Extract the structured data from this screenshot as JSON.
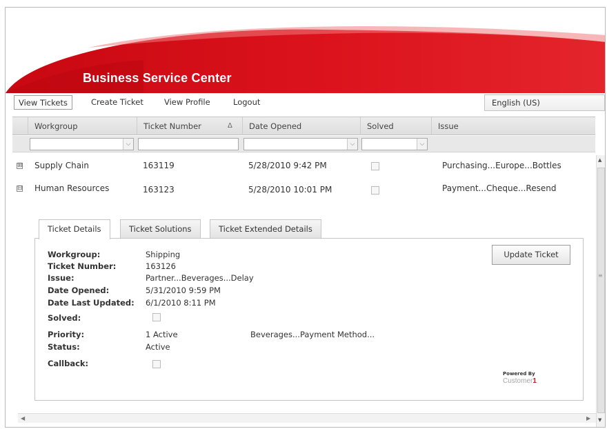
{
  "header": {
    "title": "Business Service Center"
  },
  "menu": {
    "items": [
      "View Tickets",
      "Create Ticket",
      "View Profile",
      "Logout"
    ],
    "language": "English (US)"
  },
  "grid": {
    "columns": [
      "Workgroup",
      "Ticket Number",
      "Date Opened",
      "Solved",
      "Issue"
    ],
    "sort_indicator": "Δ",
    "rows": [
      {
        "expander": "⊞",
        "workgroup": "Supply Chain",
        "ticket_number": "163119",
        "date_opened": "5/28/2010 9:42 PM",
        "issue": "Purchasing...Europe...Bottles"
      },
      {
        "expander": "⊟",
        "workgroup": "Human Resources",
        "ticket_number": "163123",
        "date_opened": "5/28/2010 10:01 PM",
        "issue": "Payment...Cheque...Resend"
      }
    ]
  },
  "detail": {
    "tabs": [
      "Ticket Details",
      "Ticket Solutions",
      "Ticket Extended Details"
    ],
    "labels": {
      "workgroup": "Workgroup:",
      "ticket_number": "Ticket Number:",
      "issue": "Issue:",
      "date_opened": "Date Opened:",
      "date_last_updated": "Date Last Updated:",
      "solved": "Solved:",
      "priority": "Priority:",
      "status": "Status:",
      "callback": "Callback:"
    },
    "values": {
      "workgroup": "Shipping",
      "ticket_number": "163126",
      "issue": "Partner...Beverages...Delay",
      "date_opened": "5/31/2010 9:59 PM",
      "date_last_updated": "6/1/2010 8:11 PM",
      "priority": "1 Active",
      "category": "Beverages...Payment Method...",
      "status": "Active"
    },
    "update_button": "Update Ticket",
    "powered_by": "Powered By",
    "brand_name": "Customer",
    "brand_number": "1"
  },
  "colors": {
    "brand_red": "#d4101a",
    "header_dark_red": "#a8000c"
  },
  "icons": {
    "dropdown": "chevron-down-icon",
    "expand": "plus-square-icon",
    "collapse": "minus-square-icon",
    "sort": "sort-ascending-icon"
  }
}
